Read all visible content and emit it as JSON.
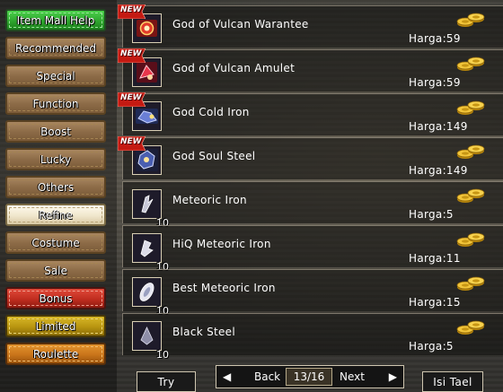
{
  "sidebar": {
    "items": [
      {
        "label": "Item Mall Help",
        "style": "green"
      },
      {
        "label": "Recommended",
        "style": "normal"
      },
      {
        "label": "Special",
        "style": "normal"
      },
      {
        "label": "Function",
        "style": "normal"
      },
      {
        "label": "Boost",
        "style": "normal"
      },
      {
        "label": "Lucky",
        "style": "normal"
      },
      {
        "label": "Others",
        "style": "normal"
      },
      {
        "label": "Refine",
        "style": "selected"
      },
      {
        "label": "Costume",
        "style": "normal"
      },
      {
        "label": "Sale",
        "style": "normal"
      },
      {
        "label": "Bonus",
        "style": "red"
      },
      {
        "label": "Limited",
        "style": "yellow"
      },
      {
        "label": "Roulette",
        "style": "orange"
      }
    ]
  },
  "items": [
    {
      "name": "God of Vulcan Warantee",
      "price": "Harga:59",
      "new": true,
      "new_label": "NEW",
      "qty": "",
      "icon": "vulcan-warantee-icon"
    },
    {
      "name": "God of Vulcan Amulet",
      "price": "Harga:59",
      "new": true,
      "new_label": "NEW",
      "qty": "",
      "icon": "vulcan-amulet-icon"
    },
    {
      "name": "God Cold Iron",
      "price": "Harga:149",
      "new": true,
      "new_label": "NEW",
      "qty": "",
      "icon": "cold-iron-icon"
    },
    {
      "name": "God Soul Steel",
      "price": "Harga:149",
      "new": true,
      "new_label": "NEW",
      "qty": "",
      "icon": "soul-steel-icon"
    },
    {
      "name": "Meteoric Iron",
      "price": "Harga:5",
      "new": false,
      "new_label": "",
      "qty": "10",
      "icon": "meteoric-iron-icon"
    },
    {
      "name": "HiQ Meteoric Iron",
      "price": "Harga:11",
      "new": false,
      "new_label": "",
      "qty": "10",
      "icon": "hiq-meteoric-iron-icon"
    },
    {
      "name": "Best Meteoric Iron",
      "price": "Harga:15",
      "new": false,
      "new_label": "",
      "qty": "10",
      "icon": "best-meteoric-iron-icon"
    },
    {
      "name": "Black Steel",
      "price": "Harga:5",
      "new": false,
      "new_label": "",
      "qty": "10",
      "icon": "black-steel-icon"
    }
  ],
  "controls": {
    "try_label": "Try",
    "back_label": "Back",
    "page": "13/16",
    "next_label": "Next",
    "prev_arrow": "◀",
    "next_arrow": "▶",
    "isi_label": "Isi Tael"
  },
  "colors": {
    "panel_bg": "#121210",
    "border": "#cfc6b0",
    "coin_gold": "#e8b830",
    "new_red": "#c41a12"
  }
}
